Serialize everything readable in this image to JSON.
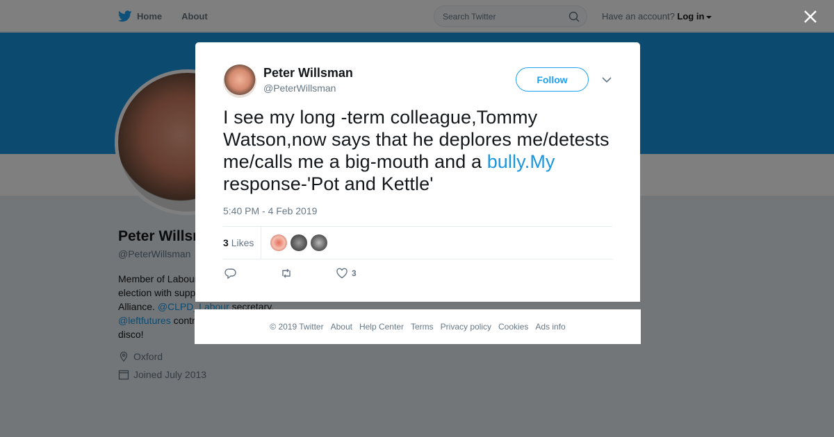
{
  "nav": {
    "home": "Home",
    "about": "About",
    "search_placeholder": "Search Twitter",
    "have_account": "Have an account?",
    "login": "Log in"
  },
  "profile": {
    "name": "Peter Willsman",
    "handle": "@PeterWillsman",
    "bio_line1": "Member of Labour",
    "bio_line2": "election with supp",
    "bio_line3a": "Alliance. ",
    "bio_link1": "@CLPD_Labour",
    "bio_line3b": " secretary.",
    "bio_link2": "@leftfutures",
    "bio_line4b": " contr",
    "bio_line5": "disco!",
    "location": "Oxford",
    "joined": "Joined July 2013"
  },
  "tweet": {
    "name": "Peter Willsman",
    "handle": "@PeterWillsman",
    "follow_label": "Follow",
    "text_before": "I see my long -term colleague,Tommy Watson,now says that he deplores me/detests me/calls me a big-mouth and a ",
    "text_link": "bully.My",
    "text_after": " response-'Pot and Kettle'",
    "timestamp": "5:40 PM - 4 Feb 2019",
    "likes_count": "3",
    "likes_label": "Likes",
    "action_like_count": "3"
  },
  "footer": {
    "links": [
      "© 2019 Twitter",
      "About",
      "Help Center",
      "Terms",
      "Privacy policy",
      "Cookies",
      "Ads info"
    ]
  },
  "colors": {
    "accent": "#1da1f2",
    "link": "#1b95e0",
    "banner": "#1b95e0"
  }
}
